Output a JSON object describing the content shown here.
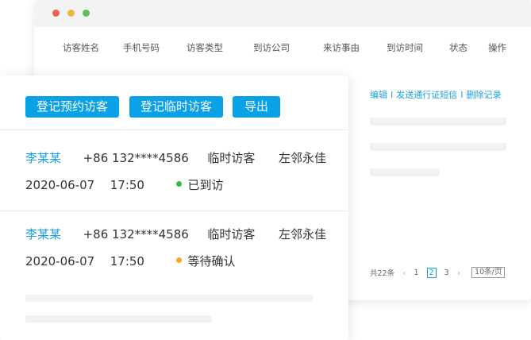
{
  "table": {
    "columns": [
      "访客姓名",
      "手机号码",
      "访客类型",
      "到访公司",
      "来访事由",
      "到访时间",
      "状态",
      "操作"
    ],
    "row_actions": [
      "编辑",
      "发送通行证短信",
      "删除记录"
    ],
    "action_separator": "I"
  },
  "pagination": {
    "total": "共22条",
    "prev": "‹",
    "pages": [
      "1",
      "2",
      "3"
    ],
    "current": "2",
    "next": "›",
    "page_size": "10条/页"
  },
  "toolbar": {
    "register_appointment": "登记预约访客",
    "register_temporary": "登记临时访客",
    "export": "导出"
  },
  "records": [
    {
      "name": "李某某",
      "phone": "+86 132****4586",
      "type": "临时访客",
      "company": "左邻永佳",
      "date": "2020-06-07",
      "time": "17:50",
      "status": "已到访",
      "status_color": "#3cb94a"
    },
    {
      "name": "李某某",
      "phone": "+86 132****4586",
      "type": "临时访客",
      "company": "左邻永佳",
      "date": "2020-06-07",
      "time": "17:50",
      "status": "等待确认",
      "status_color": "#f5a623"
    }
  ],
  "colors": {
    "accent": "#0aa1e6",
    "link": "#1a9fde"
  }
}
